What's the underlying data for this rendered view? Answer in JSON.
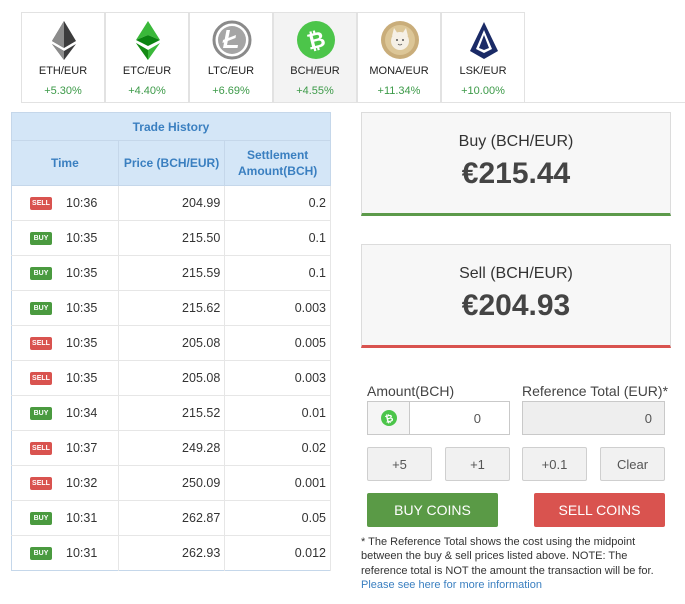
{
  "tabs": [
    {
      "pair": "ETH/EUR",
      "change": "+5.30%",
      "icon": "ethereum-icon",
      "active": false
    },
    {
      "pair": "ETC/EUR",
      "change": "+4.40%",
      "icon": "ethereum-classic-icon",
      "active": false
    },
    {
      "pair": "LTC/EUR",
      "change": "+6.69%",
      "icon": "litecoin-icon",
      "active": false
    },
    {
      "pair": "BCH/EUR",
      "change": "+4.55%",
      "icon": "bitcoin-cash-icon",
      "active": true
    },
    {
      "pair": "MONA/EUR",
      "change": "+11.34%",
      "icon": "monacoin-icon",
      "active": false
    },
    {
      "pair": "LSK/EUR",
      "change": "+10.00%",
      "icon": "lisk-icon",
      "active": false
    }
  ],
  "trade_history": {
    "title": "Trade History",
    "columns": {
      "time": "Time",
      "price": "Price (BCH/EUR)",
      "amount_line1": "Settlement",
      "amount_line2": "Amount(BCH)"
    },
    "rows": [
      {
        "side": "SELL",
        "time": "10:36",
        "price": "204.99",
        "amount": "0.2"
      },
      {
        "side": "BUY",
        "time": "10:35",
        "price": "215.50",
        "amount": "0.1"
      },
      {
        "side": "BUY",
        "time": "10:35",
        "price": "215.59",
        "amount": "0.1"
      },
      {
        "side": "BUY",
        "time": "10:35",
        "price": "215.62",
        "amount": "0.003"
      },
      {
        "side": "SELL",
        "time": "10:35",
        "price": "205.08",
        "amount": "0.005"
      },
      {
        "side": "SELL",
        "time": "10:35",
        "price": "205.08",
        "amount": "0.003"
      },
      {
        "side": "BUY",
        "time": "10:34",
        "price": "215.52",
        "amount": "0.01"
      },
      {
        "side": "SELL",
        "time": "10:37",
        "price": "249.28",
        "amount": "0.02"
      },
      {
        "side": "SELL",
        "time": "10:32",
        "price": "250.09",
        "amount": "0.001"
      },
      {
        "side": "BUY",
        "time": "10:31",
        "price": "262.87",
        "amount": "0.05"
      },
      {
        "side": "BUY",
        "time": "10:31",
        "price": "262.93",
        "amount": "0.012"
      }
    ]
  },
  "buy_panel": {
    "label": "Buy (BCH/EUR)",
    "price": "€215.44"
  },
  "sell_panel": {
    "label": "Sell (BCH/EUR)",
    "price": "€204.93"
  },
  "form": {
    "amount_label": "Amount(BCH)",
    "amount_value": "0",
    "reference_label": "Reference Total (EUR)*",
    "reference_value": "0",
    "step_buttons": [
      "+5",
      "+1",
      "+0.1",
      "Clear"
    ],
    "buy_button": "BUY COINS",
    "sell_button": "SELL COINS"
  },
  "note": {
    "text": "* The Reference Total shows the cost using the midpoint between the buy & sell prices listed above. NOTE: The reference total is NOT the amount the transaction will be for.",
    "link": "Please see here for more information"
  },
  "colors": {
    "accent_blue": "#3a7fc0",
    "positive_green": "#3c9a48",
    "buy_green": "#5a9a46",
    "sell_red": "#d9534f"
  }
}
